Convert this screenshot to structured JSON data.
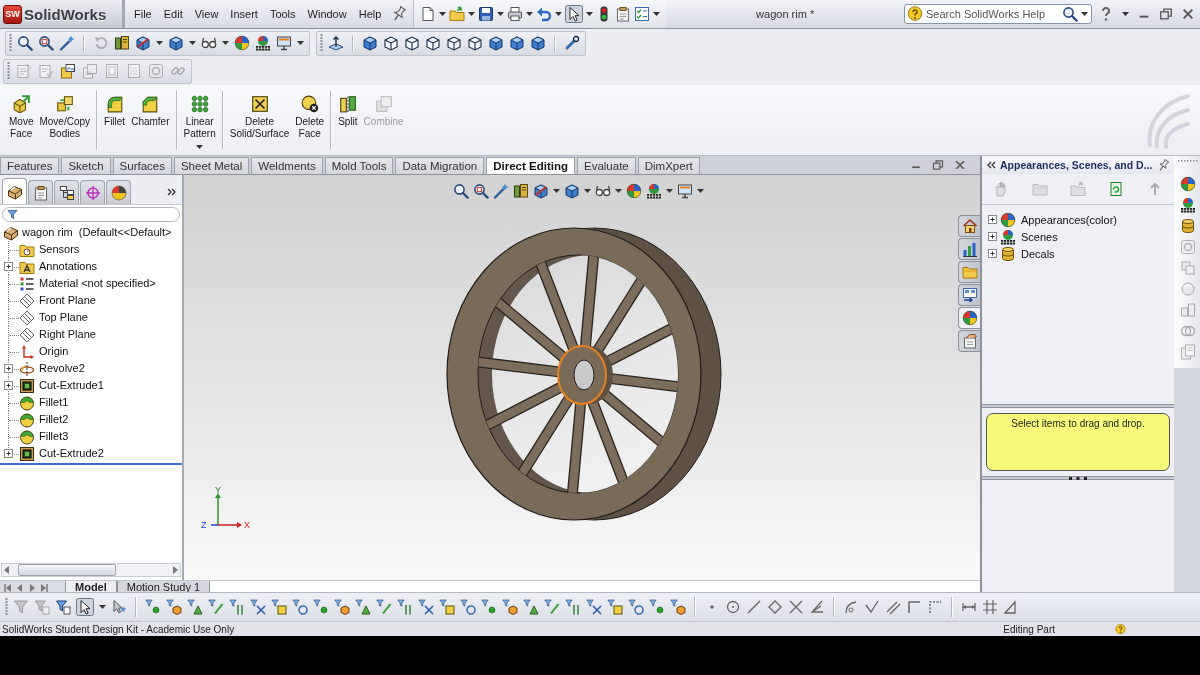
{
  "title_bar": {
    "logo_badge": "SW",
    "logo_text": "SolidWorks",
    "menu": [
      "File",
      "Edit",
      "View",
      "Insert",
      "Tools",
      "Window",
      "Help"
    ],
    "select_tool": {
      "selected": true
    },
    "document_title": "wagon rim *",
    "search": {
      "placeholder": "Search SolidWorks Help"
    }
  },
  "view_toolbar": [
    {
      "disabled": false
    },
    {
      "disabled": false
    },
    {
      "disabled": false
    },
    {
      "disabled": true
    },
    {
      "disabled": false
    },
    {
      "disabled": false
    },
    {
      "disabled": false
    },
    {
      "disabled": false
    },
    {
      "disabled": false
    },
    {
      "disabled": false
    },
    {
      "disabled": false
    }
  ],
  "annotation_toolbar": [
    {
      "disabled": true
    },
    {
      "disabled": true
    },
    {
      "disabled": false
    },
    {
      "disabled": true
    },
    {
      "disabled": true
    },
    {
      "disabled": true
    },
    {
      "disabled": true
    },
    {
      "disabled": true
    }
  ],
  "command_manager": {
    "buttons": [
      {
        "label": "Move Face",
        "disabled": false,
        "dropdown": false
      },
      {
        "label": "Move/Copy Bodies",
        "disabled": false,
        "dropdown": false
      },
      {
        "label": "Fillet",
        "disabled": false,
        "dropdown": false
      },
      {
        "label": "Chamfer",
        "disabled": false,
        "dropdown": false
      },
      {
        "label": "Linear Pattern",
        "disabled": false,
        "dropdown": true
      },
      {
        "label": "Delete Solid/Surface",
        "disabled": false,
        "dropdown": false
      },
      {
        "label": "Delete Face",
        "disabled": false,
        "dropdown": false
      },
      {
        "label": "Split",
        "disabled": false,
        "dropdown": false
      },
      {
        "label": "Combine",
        "disabled": true,
        "dropdown": false
      }
    ],
    "tabs": [
      {
        "label": "Features",
        "selected": false
      },
      {
        "label": "Sketch",
        "selected": false
      },
      {
        "label": "Surfaces",
        "selected": false
      },
      {
        "label": "Sheet Metal",
        "selected": false
      },
      {
        "label": "Weldments",
        "selected": false
      },
      {
        "label": "Mold Tools",
        "selected": false
      },
      {
        "label": "Data Migration",
        "selected": false
      },
      {
        "label": "Direct Editing",
        "selected": true
      },
      {
        "label": "Evaluate",
        "selected": false
      },
      {
        "label": "DimXpert",
        "selected": false
      }
    ]
  },
  "feature_manager": {
    "tabs": [
      {
        "selected": true
      },
      {
        "selected": false
      },
      {
        "selected": false
      },
      {
        "selected": false
      },
      {
        "selected": false
      }
    ],
    "root": "wagon rim  (Default<<Default>",
    "items": [
      {
        "label": "Sensors",
        "kind": "sensors",
        "expandable": false
      },
      {
        "label": "Annotations",
        "kind": "annotations",
        "expandable": true
      },
      {
        "label": "Material <not specified>",
        "kind": "material",
        "expandable": false
      },
      {
        "label": "Front Plane",
        "kind": "plane",
        "expandable": false
      },
      {
        "label": "Top Plane",
        "kind": "plane",
        "expandable": false
      },
      {
        "label": "Right Plane",
        "kind": "plane",
        "expandable": false
      },
      {
        "label": "Origin",
        "kind": "origin",
        "expandable": false
      },
      {
        "label": "Revolve2",
        "kind": "revolve",
        "expandable": true
      },
      {
        "label": "Cut-Extrude1",
        "kind": "cut",
        "expandable": true
      },
      {
        "label": "Fillet1",
        "kind": "fillet",
        "expandable": false
      },
      {
        "label": "Fillet2",
        "kind": "fillet",
        "expandable": false
      },
      {
        "label": "Fillet3",
        "kind": "fillet",
        "expandable": false
      },
      {
        "label": "Cut-Extrude2",
        "kind": "cut",
        "expandable": true
      }
    ]
  },
  "graphics": {
    "triad": [
      "Y",
      "Z",
      "X"
    ],
    "task_pane_tabs": [
      {
        "selected": false
      },
      {
        "selected": false
      },
      {
        "selected": false
      },
      {
        "selected": false
      },
      {
        "selected": true
      },
      {
        "selected": false
      }
    ]
  },
  "bottom_tabs": [
    {
      "label": "Model",
      "selected": true
    },
    {
      "label": "Motion Study 1",
      "selected": false
    }
  ],
  "task_pane": {
    "title": "Appearances, Scenes, and D...",
    "toolbar": [
      {
        "disabled": true
      },
      {
        "disabled": true
      },
      {
        "disabled": true
      },
      {
        "disabled": false
      },
      {
        "disabled": true
      }
    ],
    "items": [
      {
        "label": "Appearances(color)",
        "kind": "appearances",
        "expandable": true
      },
      {
        "label": "Scenes",
        "kind": "scenes",
        "expandable": true
      },
      {
        "label": "Decals",
        "kind": "decals",
        "expandable": true
      }
    ],
    "message": "Select items to drag and drop.",
    "side_icons": [
      {
        "disabled": false
      },
      {
        "disabled": false
      },
      {
        "disabled": false
      },
      {
        "disabled": true
      },
      {
        "disabled": true
      },
      {
        "disabled": true
      },
      {
        "disabled": true
      },
      {
        "disabled": true
      },
      {
        "disabled": true
      }
    ]
  },
  "selection_toolbar": {
    "filter_buttons": [
      {
        "disabled": true
      },
      {
        "disabled": true
      },
      {
        "disabled": false
      }
    ],
    "select_tool": {
      "selected": true
    }
  },
  "status_bar": {
    "text": "SolidWorks Student Design Kit - Academic Use Only",
    "mode": "Editing Part"
  }
}
